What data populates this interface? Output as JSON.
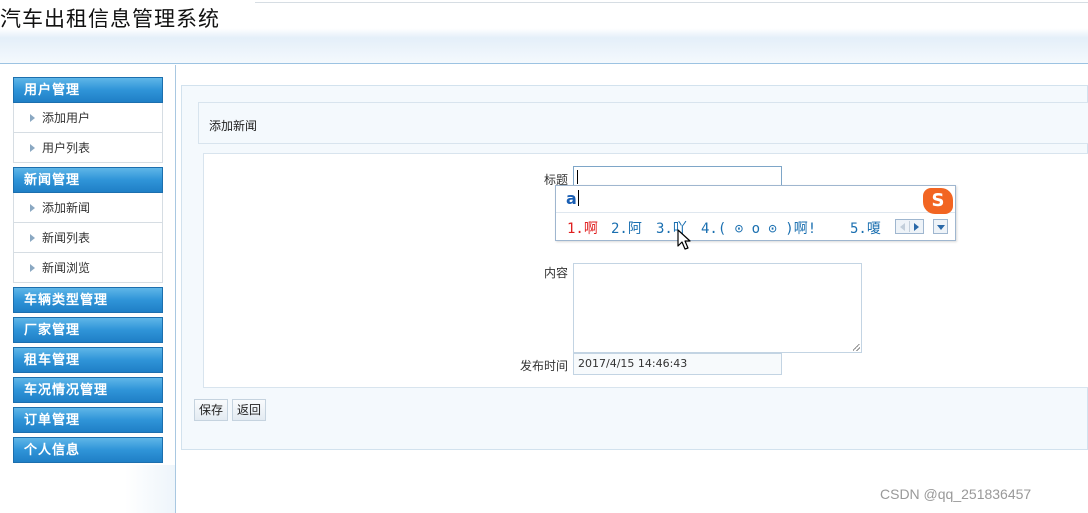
{
  "header": {
    "title": "汽车出租信息管理系统"
  },
  "sidebar": {
    "groups": [
      {
        "label": "用户管理",
        "items": [
          {
            "label": "添加用户"
          },
          {
            "label": "用户列表"
          }
        ]
      },
      {
        "label": "新闻管理",
        "items": [
          {
            "label": "添加新闻"
          },
          {
            "label": "新闻列表"
          },
          {
            "label": "新闻浏览"
          }
        ]
      },
      {
        "label": "车辆类型管理",
        "items": []
      },
      {
        "label": "厂家管理",
        "items": []
      },
      {
        "label": "租车管理",
        "items": []
      },
      {
        "label": "车况情况管理",
        "items": []
      },
      {
        "label": "订单管理",
        "items": []
      },
      {
        "label": "个人信息",
        "items": []
      }
    ]
  },
  "main": {
    "section_title": "添加新闻",
    "form": {
      "title_label": "标题",
      "title_value": "",
      "content_label": "内容",
      "content_value": "",
      "time_label": "发布时间",
      "time_value": "2017/4/15 14:46:43"
    },
    "buttons": {
      "save": "保存",
      "back": "返回"
    }
  },
  "ime": {
    "composition": "a",
    "logo": "S",
    "candidates": [
      "1.啊",
      "2.阿",
      "3.吖",
      "4.( ⊙ o ⊙ )啊!",
      "5.嗄"
    ]
  },
  "watermark": "CSDN @qq_251836457",
  "icons": {
    "menu_arrow": "arrow-right-icon",
    "ime_prev": "arrow-left-icon",
    "ime_next": "arrow-right-icon",
    "ime_menu": "chevron-down-icon",
    "cursor": "mouse-pointer-icon",
    "ime_logo": "sogou-logo-icon"
  },
  "colors": {
    "menu_head": "#2f94d8",
    "ime_first": "#e02020",
    "ime_cand": "#1a6fb0",
    "ime_logo": "#f26522"
  }
}
